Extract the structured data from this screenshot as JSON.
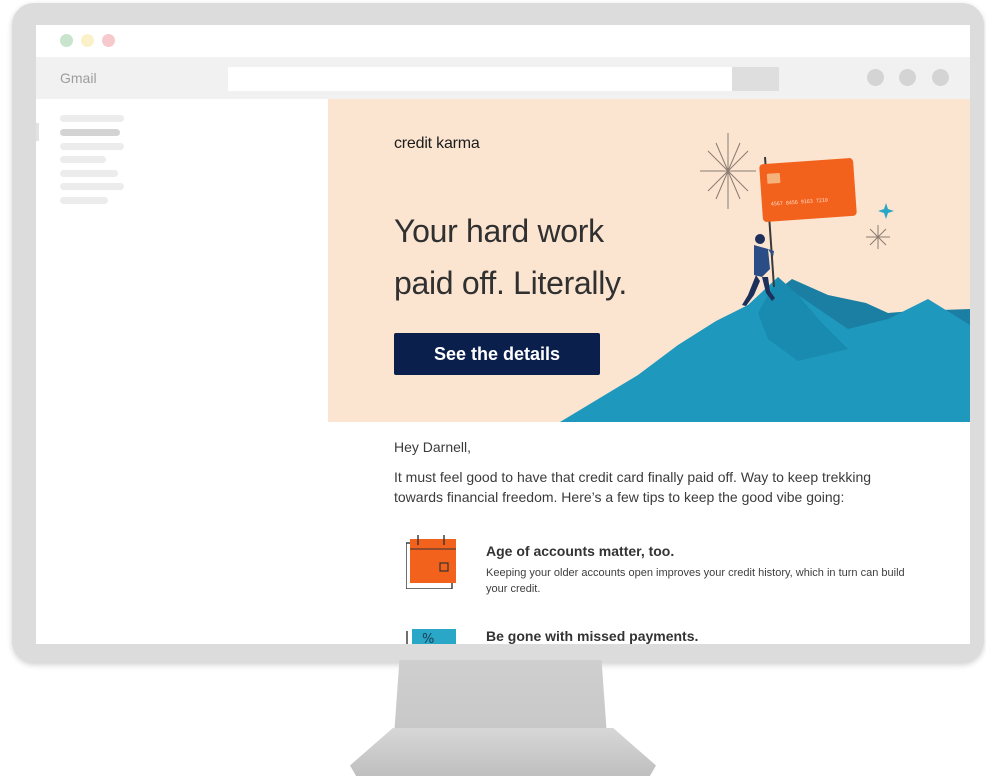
{
  "browser": {
    "app_name": "Gmail"
  },
  "email": {
    "brand": "credit karma",
    "headline_line1": "Your hard work",
    "headline_line2": "paid off. Literally.",
    "cta_label": "See the details",
    "greeting": "Hey Darnell,",
    "intro": "It must feel good to have that credit card finally paid off. Way to keep trekking towards financial freedom. Here’s a few tips to keep the good vibe going:",
    "tips": [
      {
        "title": "Age of accounts matter, too.",
        "description": "Keeping your older accounts open improves your credit history, which in turn can build your credit.",
        "icon": "calendar-icon"
      },
      {
        "title": "Be gone with missed payments.",
        "description": "",
        "icon": "percent-tag-icon"
      }
    ]
  },
  "colors": {
    "hero_background": "#fbe5d1",
    "cta_background": "#0b1f4d",
    "mountain": "#1b8fb3",
    "card": "#f3621d",
    "icon_orange": "#f3621d",
    "icon_blue": "#2aa6c7"
  },
  "hero_illustration": {
    "card_text": "4567 8456 9163 7210"
  }
}
